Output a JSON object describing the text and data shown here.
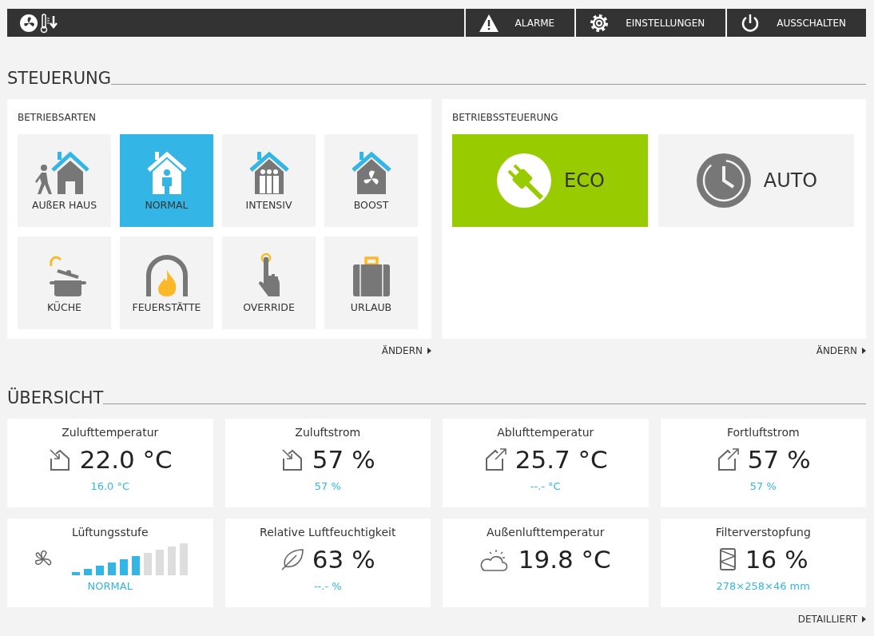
{
  "topbar": {
    "buttons": [
      {
        "label": "ALARME",
        "kind": "alarm"
      },
      {
        "label": "EINSTELLUNGEN",
        "kind": "settings"
      },
      {
        "label": "AUSSCHALTEN",
        "kind": "power"
      }
    ]
  },
  "steuerung": {
    "title": "STEUERUNG",
    "betriebsarten": {
      "title": "BETRIEBSARTEN",
      "modes": [
        {
          "label": "AUßER HAUS",
          "kind": "away",
          "selected": false
        },
        {
          "label": "NORMAL",
          "kind": "normal",
          "selected": true
        },
        {
          "label": "INTENSIV",
          "kind": "intensive",
          "selected": false
        },
        {
          "label": "BOOST",
          "kind": "boost",
          "selected": false
        },
        {
          "label": "KÜCHE",
          "kind": "kitchen",
          "selected": false
        },
        {
          "label": "FEUERSTÄTTE",
          "kind": "fireplace",
          "selected": false
        },
        {
          "label": "OVERRIDE",
          "kind": "override",
          "selected": false
        },
        {
          "label": "URLAUB",
          "kind": "vacation",
          "selected": false
        }
      ],
      "link": "ÄNDERN"
    },
    "betriebssteuerung": {
      "title": "BETRIEBSSTEUERUNG",
      "options": [
        {
          "label": "ECO",
          "kind": "eco",
          "selected": true
        },
        {
          "label": "AUTO",
          "kind": "auto",
          "selected": false
        }
      ],
      "link": "ÄNDERN"
    }
  },
  "uebersicht": {
    "title": "ÜBERSICHT",
    "cards": [
      {
        "title": "Zulufttemperatur",
        "kind": "supply",
        "value": "22.0 °C",
        "sub": "16.0 °C"
      },
      {
        "title": "Zuluftstrom",
        "kind": "supply",
        "value": "57 %",
        "sub": "57 %"
      },
      {
        "title": "Ablufttemperatur",
        "kind": "exhaust",
        "value": "25.7 °C",
        "sub": "--.- °C"
      },
      {
        "title": "Fortluftstrom",
        "kind": "exhaust",
        "value": "57 %",
        "sub": "57 %"
      },
      {
        "title": "Lüftungsstufe",
        "kind": "fanlevel",
        "level": 0.6,
        "sub": "NORMAL"
      },
      {
        "title": "Relative Luftfeuchtigkeit",
        "kind": "humidity",
        "value": "63 %",
        "sub": "--.- %"
      },
      {
        "title": "Außenlufttemperatur",
        "kind": "weather",
        "value": "19.8 °C"
      },
      {
        "title": "Filterverstopfung",
        "kind": "filter",
        "value": "16 %",
        "sub": "278×258×46 mm"
      }
    ],
    "link": "DETAILLIERT"
  }
}
